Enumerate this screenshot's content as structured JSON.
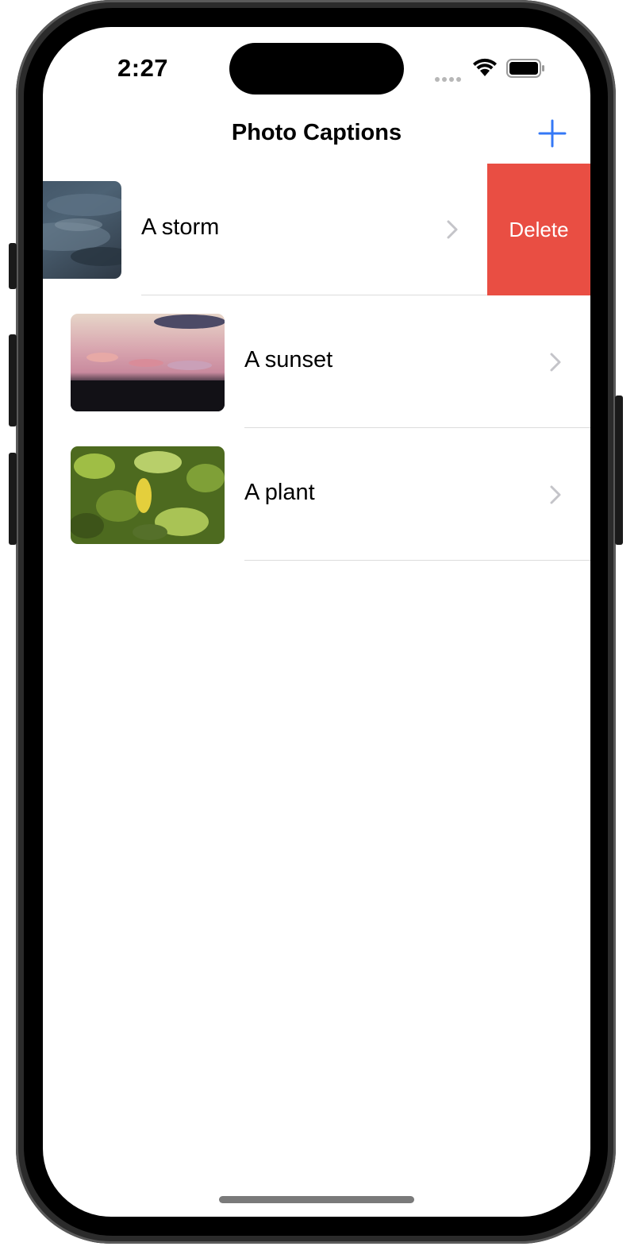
{
  "status_bar": {
    "time": "2:27"
  },
  "nav": {
    "title": "Photo Captions",
    "add_icon": "plus-icon",
    "accent_color": "#3478f6"
  },
  "rows": [
    {
      "caption": "A storm",
      "thumbnail": "storm-photo",
      "swiped": true
    },
    {
      "caption": "A sunset",
      "thumbnail": "sunset-photo",
      "swiped": false
    },
    {
      "caption": "A plant",
      "thumbnail": "plant-photo",
      "swiped": false
    }
  ],
  "swipe_action": {
    "label": "Delete",
    "color": "#e94e43"
  }
}
